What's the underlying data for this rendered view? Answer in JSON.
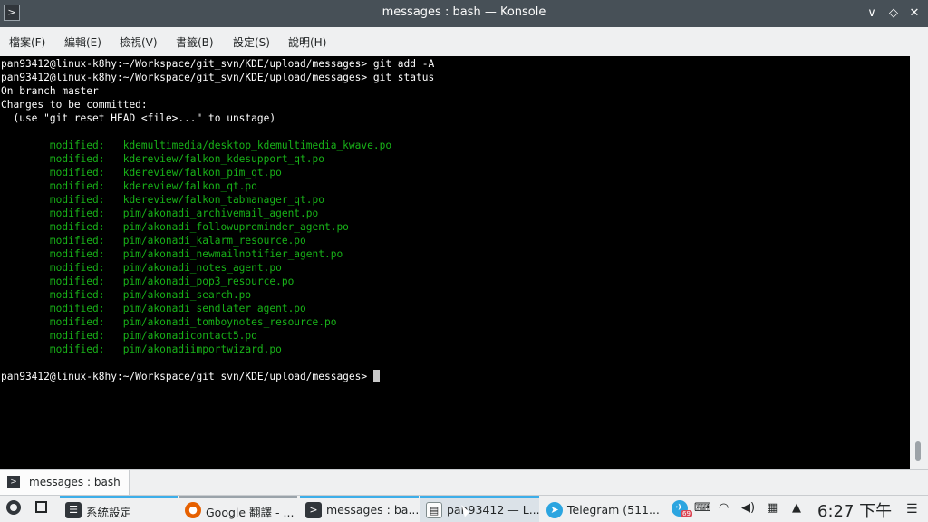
{
  "window": {
    "title": "messages : bash — Konsole",
    "buttons": [
      "∨",
      "◇",
      "✕"
    ]
  },
  "menubar": {
    "items": [
      "檔案(F)",
      "編輯(E)",
      "檢視(V)",
      "書籤(B)",
      "設定(S)",
      "說明(H)"
    ]
  },
  "terminal": {
    "prompt": "pan93412@linux-k8hy:~/Workspace/git_svn/KDE/upload/messages>",
    "lines": [
      {
        "text": "pan93412@linux-k8hy:~/Workspace/git_svn/KDE/upload/messages> git add -A",
        "kind": "plain"
      },
      {
        "text": "pan93412@linux-k8hy:~/Workspace/git_svn/KDE/upload/messages> git status",
        "kind": "plain"
      },
      {
        "text": "On branch master",
        "kind": "plain"
      },
      {
        "text": "Changes to be committed:",
        "kind": "plain"
      },
      {
        "text": "  (use \"git reset HEAD <file>...\" to unstage)",
        "kind": "plain"
      },
      {
        "text": "",
        "kind": "plain"
      },
      {
        "text": "        modified:   kdemultimedia/desktop_kdemultimedia_kwave.po",
        "kind": "mod"
      },
      {
        "text": "        modified:   kdereview/falkon_kdesupport_qt.po",
        "kind": "mod"
      },
      {
        "text": "        modified:   kdereview/falkon_pim_qt.po",
        "kind": "mod"
      },
      {
        "text": "        modified:   kdereview/falkon_qt.po",
        "kind": "mod"
      },
      {
        "text": "        modified:   kdereview/falkon_tabmanager_qt.po",
        "kind": "mod"
      },
      {
        "text": "        modified:   pim/akonadi_archivemail_agent.po",
        "kind": "mod"
      },
      {
        "text": "        modified:   pim/akonadi_followupreminder_agent.po",
        "kind": "mod"
      },
      {
        "text": "        modified:   pim/akonadi_kalarm_resource.po",
        "kind": "mod"
      },
      {
        "text": "        modified:   pim/akonadi_newmailnotifier_agent.po",
        "kind": "mod"
      },
      {
        "text": "        modified:   pim/akonadi_notes_agent.po",
        "kind": "mod"
      },
      {
        "text": "        modified:   pim/akonadi_pop3_resource.po",
        "kind": "mod"
      },
      {
        "text": "        modified:   pim/akonadi_search.po",
        "kind": "mod"
      },
      {
        "text": "        modified:   pim/akonadi_sendlater_agent.po",
        "kind": "mod"
      },
      {
        "text": "        modified:   pim/akonadi_tomboynotes_resource.po",
        "kind": "mod"
      },
      {
        "text": "        modified:   pim/akonadicontact5.po",
        "kind": "mod"
      },
      {
        "text": "        modified:   pim/akonadiimportwizard.po",
        "kind": "mod"
      },
      {
        "text": "",
        "kind": "plain"
      }
    ],
    "colors": {
      "background": "#000000",
      "foreground": "#fcfcfc",
      "modified": "#18b218"
    }
  },
  "tabbar": {
    "tab_label": "messages : bash"
  },
  "taskbar": {
    "tasks": [
      {
        "label": "系統設定",
        "icon": "settings-icon",
        "state": "open"
      },
      {
        "label": "Google 翻譯 - ...",
        "icon": "firefox-icon",
        "state": "inact"
      },
      {
        "label": "messages : ba...",
        "icon": "konsole-icon",
        "state": "open"
      },
      {
        "label": "pan93412 — L...",
        "icon": "file-manager-icon",
        "state": "active"
      },
      {
        "label": "Telegram (511...",
        "icon": "telegram-icon",
        "state": "none"
      }
    ],
    "tray": {
      "badge": "69",
      "clock": "6:27 下午"
    },
    "accent": "#3daee9"
  }
}
